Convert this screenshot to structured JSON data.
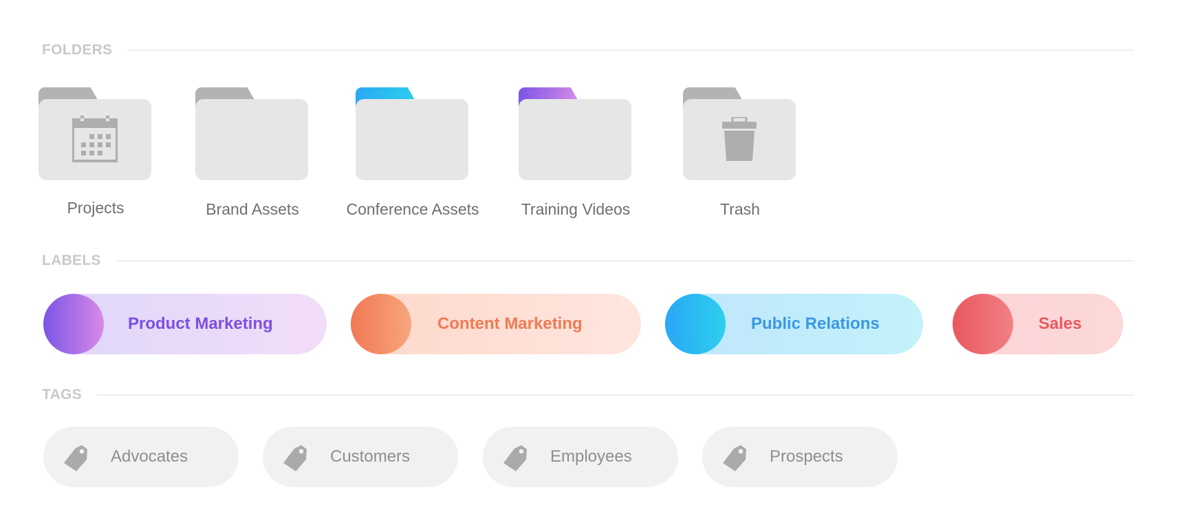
{
  "sections": {
    "folders": "FOLDERS",
    "labels": "LABELS",
    "tags": "TAGS"
  },
  "folders": [
    {
      "name": "Projects",
      "icon": "calendar-icon",
      "tab_color": [
        "#b3b3b3",
        "#b3b3b3"
      ]
    },
    {
      "name": "Brand Assets",
      "icon": null,
      "tab_color": [
        "#b3b3b3",
        "#b3b3b3"
      ]
    },
    {
      "name": "Conference Assets",
      "icon": null,
      "tab_color": [
        "#2aa9f5",
        "#2ccdee"
      ]
    },
    {
      "name": "Training Videos",
      "icon": null,
      "tab_color": [
        "#7b55e6",
        "#d48ae8"
      ]
    },
    {
      "name": "Trash",
      "icon": "trash-icon",
      "tab_color": [
        "#b3b3b3",
        "#b3b3b3"
      ]
    }
  ],
  "labels": [
    {
      "name": "Product Marketing",
      "text_color": "#7c4fe0",
      "dot_colors": [
        "#7b55e6",
        "#d88ae8"
      ],
      "bg_colors": [
        "#ded7fa",
        "#f2ddf8"
      ]
    },
    {
      "name": "Content Marketing",
      "text_color": "#f07a55",
      "dot_colors": [
        "#f07a55",
        "#f8a57d"
      ],
      "bg_colors": [
        "#fdd8cb",
        "#fee6de"
      ]
    },
    {
      "name": "Public Relations",
      "text_color": "#3b97e3",
      "dot_colors": [
        "#2ba6f6",
        "#2cd0ee"
      ],
      "bg_colors": [
        "#bfe6fb",
        "#c3f2fb"
      ]
    },
    {
      "name": "Sales",
      "text_color": "#e85a5f",
      "dot_colors": [
        "#e9575e",
        "#f08084"
      ],
      "bg_colors": [
        "#fcd5d6",
        "#fcd8d9"
      ]
    }
  ],
  "tags": [
    {
      "name": "Advocates",
      "icon": "tag-icon"
    },
    {
      "name": "Customers",
      "icon": "tag-icon"
    },
    {
      "name": "Employees",
      "icon": "tag-icon"
    },
    {
      "name": "Prospects",
      "icon": "tag-icon"
    }
  ]
}
